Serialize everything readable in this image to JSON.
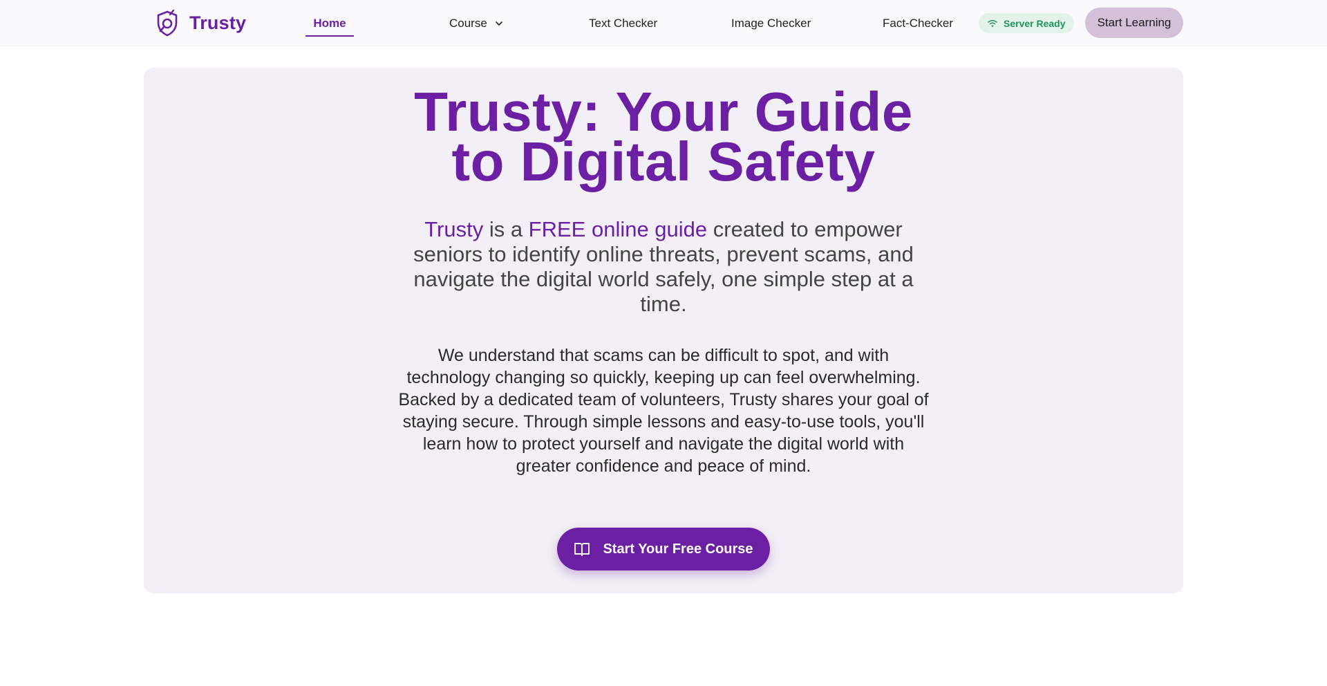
{
  "brand": {
    "name": "Trusty",
    "logo_icon": "shield-lock-icon",
    "accent_color": "#6b1fa3"
  },
  "nav": {
    "home": "Home",
    "course": "Course",
    "text_checker": "Text Checker",
    "image_checker": "Image Checker",
    "fact_checker": "Fact-Checker"
  },
  "status": {
    "label": "Server Ready",
    "icon": "wifi-icon",
    "color": "#20955a"
  },
  "header_cta": "Start Learning",
  "hero": {
    "title_line1": "Trusty: Your Guide",
    "title_line2": "to Digital Safety",
    "lead_brand": "Trusty",
    "lead_part1": " is a ",
    "lead_highlight": "FREE online guide",
    "lead_part2": " created to empower seniors to identify online threats, prevent scams, and navigate the digital world safely, one simple step at a time.",
    "body": "We understand that scams can be difficult to spot, and with technology changing so quickly, keeping up can feel overwhelming. Backed by a dedicated team of volunteers, Trusty shares your goal of staying secure. Through simple lessons and easy-to-use tools, you'll learn how to protect yourself and navigate the digital world with greater confidence and peace of mind.",
    "cta_label": "Start Your Free Course",
    "cta_icon": "book-open-icon"
  }
}
